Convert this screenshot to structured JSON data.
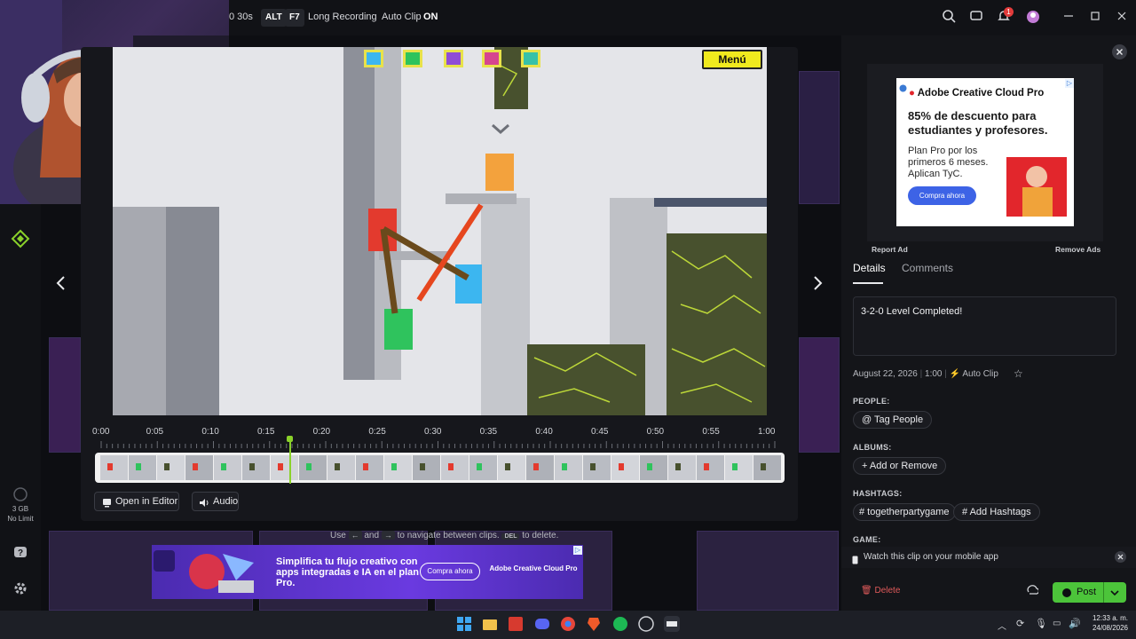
{
  "topbar": {
    "duration_hint": "0 30s",
    "alt_key": "ALT",
    "f7_key": "F7",
    "long_recording": "Long Recording",
    "auto_clip_label": "Auto Clip",
    "auto_clip_state": "ON",
    "notification_count": "1"
  },
  "left_rail": {
    "storage": "3 GB",
    "storage_limit": "No Limit"
  },
  "game": {
    "menu_label": "Menú"
  },
  "timeline": {
    "ticks": [
      "0:00",
      "0:05",
      "0:10",
      "0:15",
      "0:20",
      "0:25",
      "0:30",
      "0:35",
      "0:40",
      "0:45",
      "0:50",
      "0:55",
      "1:00"
    ],
    "playhead_time_seconds": 17
  },
  "actions": {
    "open_in_editor": "Open in Editor",
    "audio": "Audio"
  },
  "nav_hint": {
    "prefix": "Use",
    "and": "and",
    "suffix": "to navigate between clips.",
    "del_key": "DEL",
    "delete_text": "to delete."
  },
  "bottom_ad": {
    "headline": "Simplifica tu flujo creativo con apps integradas e IA en el plan Pro.",
    "cta": "Compra ahora",
    "brand": "Adobe Creative Cloud Pro"
  },
  "side_ad": {
    "brand": "Adobe Creative Cloud Pro",
    "headline": "85% de descuento para estudiantes y profesores.",
    "body": "Plan Pro por los primeros 6 meses. Aplican TyC.",
    "cta": "Compra ahora",
    "report": "Report Ad",
    "remove": "Remove Ads"
  },
  "details": {
    "tabs": [
      "Details",
      "Comments"
    ],
    "title": "3-2-0 Level Completed!",
    "date": "August 22, 2026",
    "length": "1:00",
    "type": "Auto Clip",
    "people_label": "PEOPLE:",
    "tag_people": "Tag People",
    "albums_label": "ALBUMS:",
    "add_remove": "Add or Remove",
    "hashtags_label": "HASHTAGS:",
    "hashtag": "# togetherpartygame",
    "add_hashtags": "Add Hashtags",
    "game_label": "GAME:",
    "mobile_notice": "Watch this clip on your mobile app",
    "delete": "Delete",
    "post": "Post"
  },
  "taskbar": {
    "time": "12:33 a. m.",
    "date": "24/08/2026"
  },
  "colors": {
    "accent_green": "#8ad12a",
    "post_green": "#4cc43a",
    "brand_red": "#e2262c"
  }
}
